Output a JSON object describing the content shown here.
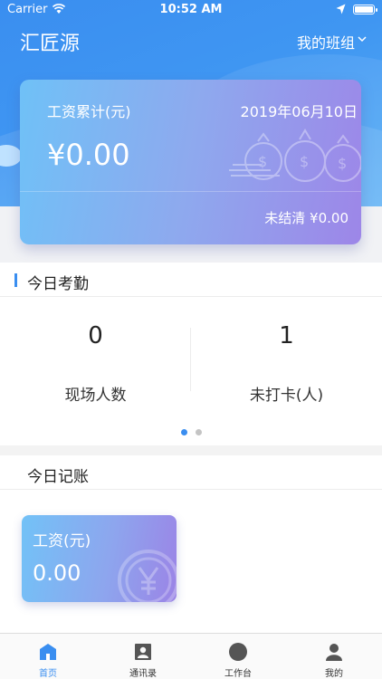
{
  "status_bar": {
    "carrier": "Carrier",
    "time": "10:52 AM"
  },
  "header": {
    "app_title": "汇匠源",
    "team_selector": "我的班组"
  },
  "salary_card": {
    "label": "工资累计(元)",
    "date": "2019年06月10日",
    "amount": "¥0.00",
    "unsettled": "未结清 ¥0.00"
  },
  "attendance": {
    "title": "今日考勤",
    "stats": [
      {
        "value": "0",
        "label": "现场人数"
      },
      {
        "value": "1",
        "label": "未打卡(人)"
      }
    ],
    "pager": {
      "pages": 2,
      "active": 0
    }
  },
  "ledger": {
    "title": "今日记账",
    "wage_card": {
      "label": "工资(元)",
      "value": "0.00"
    }
  },
  "tabbar": {
    "items": [
      {
        "label": "首页",
        "icon": "home-icon",
        "active": true
      },
      {
        "label": "通讯录",
        "icon": "contacts-icon",
        "active": false
      },
      {
        "label": "工作台",
        "icon": "workbench-icon",
        "active": false
      },
      {
        "label": "我的",
        "icon": "profile-icon",
        "active": false
      }
    ]
  },
  "colors": {
    "accent": "#3a8ef0",
    "card_gradient_start": "#6fc1f7",
    "card_gradient_end": "#9d86e8"
  }
}
